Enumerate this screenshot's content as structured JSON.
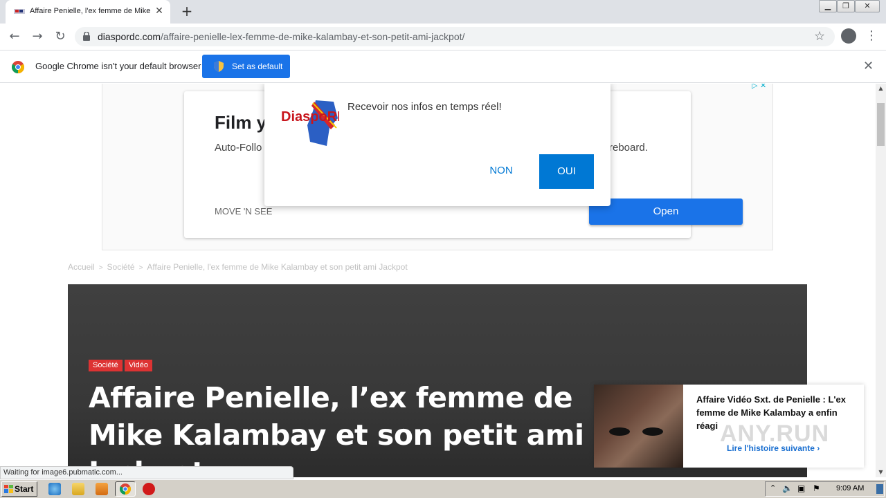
{
  "browser": {
    "tab_title": "Affaire Penielle, l'ex femme de Mike Kalambay",
    "url_domain": "diaspordc.com",
    "url_path": "/affaire-penielle-lex-femme-de-mike-kalambay-et-son-petit-ami-jackpot/",
    "infobar_message": "Google Chrome isn't your default browser",
    "set_default_label": "Set as default"
  },
  "ad": {
    "headline": "Film y",
    "desc_left": "Auto-Follo",
    "desc_right": "reboard.",
    "advertiser": "MOVE 'N SEE",
    "cta": "Open"
  },
  "push_prompt": {
    "logo_text": "DiaspoRDC",
    "message": "Recevoir nos infos en temps réel!",
    "deny_label": "NON",
    "accept_label": "OUI"
  },
  "breadcrumb": [
    "Accueil",
    "Société",
    "Affaire Penielle, l'ex femme de Mike Kalambay et son petit ami Jackpot"
  ],
  "article": {
    "categories": [
      "Société",
      "Vidéo"
    ],
    "headline": "Affaire Penielle, l’ex femme de Mike Kalambay et son petit ami Jackpot"
  },
  "next_story": {
    "title": "Affaire Vidéo Sxt. de Penielle : L'ex femme de Mike Kalambay a enfin réagi",
    "link_label": "Lire l'histoire suivante ›"
  },
  "watermark": "ANY.RUN",
  "status_text": "Waiting for image6.pubmatic.com...",
  "taskbar": {
    "start_label": "Start",
    "clock": "9:09 AM"
  },
  "colors": {
    "chrome_blue": "#1a73e8",
    "push_blue": "#0078d4",
    "category_red": "#dd3333",
    "hero_bg": "#3a3a3a"
  }
}
